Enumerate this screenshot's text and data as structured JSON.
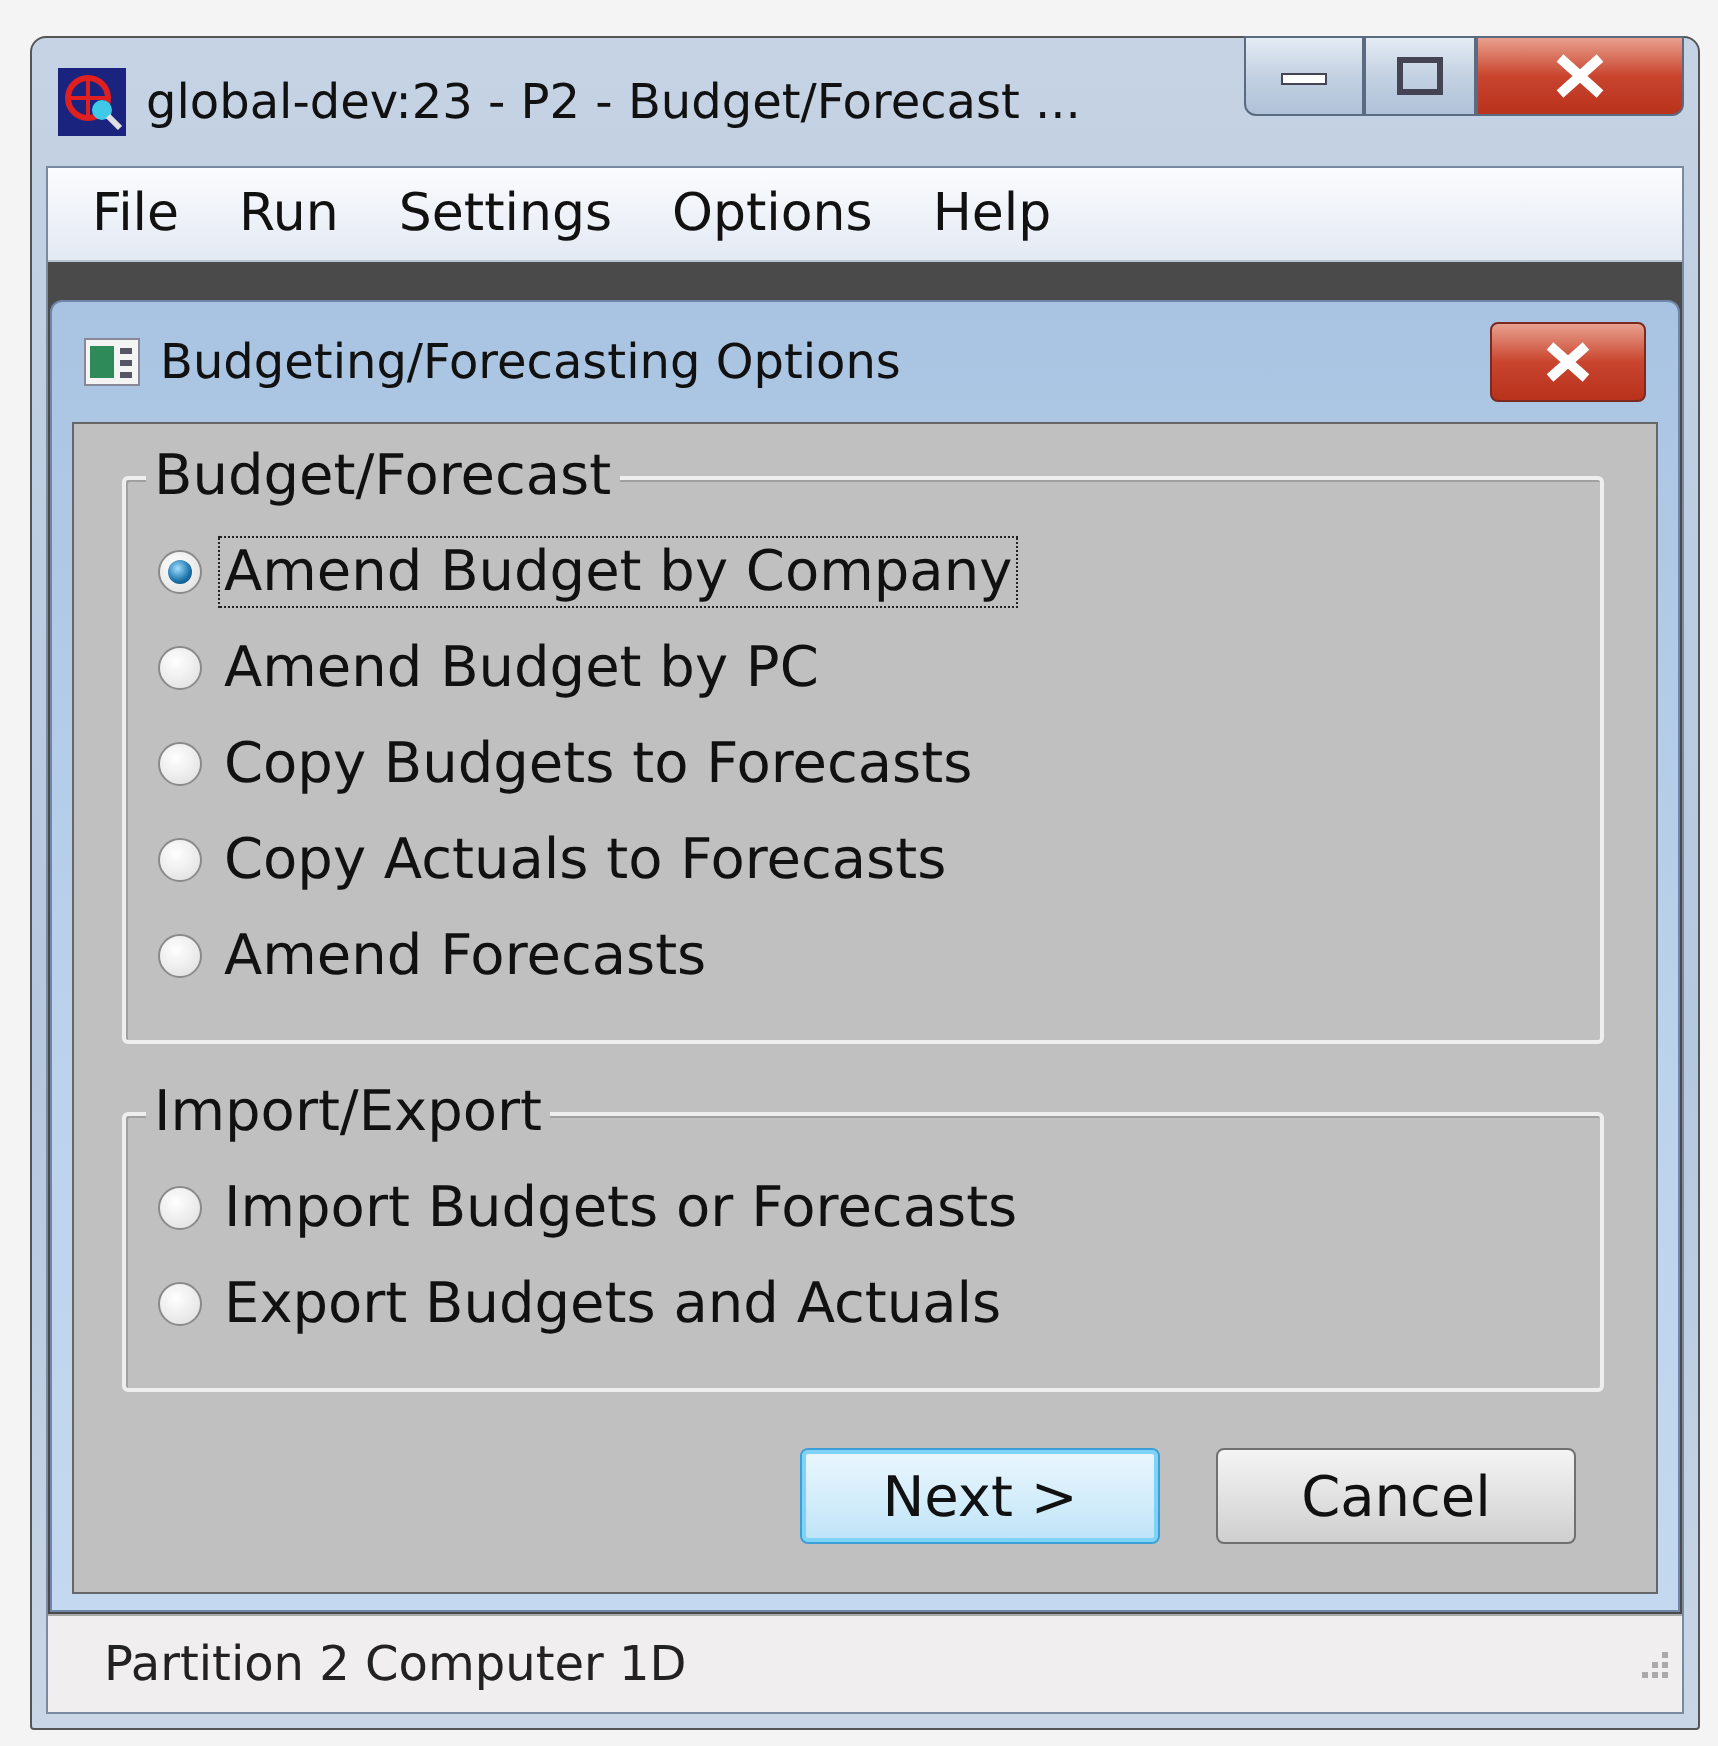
{
  "window": {
    "title": "global-dev:23 - P2 - Budget/Forecast ..."
  },
  "menu": [
    {
      "label": "File"
    },
    {
      "label": "Run"
    },
    {
      "label": "Settings"
    },
    {
      "label": "Options"
    },
    {
      "label": "Help"
    }
  ],
  "dialog": {
    "title": "Budgeting/Forecasting Options",
    "groups": [
      {
        "title": "Budget/Forecast",
        "options": [
          {
            "label": "Amend Budget by Company",
            "selected": true
          },
          {
            "label": "Amend Budget by PC",
            "selected": false
          },
          {
            "label": "Copy Budgets to Forecasts",
            "selected": false
          },
          {
            "label": "Copy Actuals to Forecasts",
            "selected": false
          },
          {
            "label": "Amend Forecasts",
            "selected": false
          }
        ]
      },
      {
        "title": "Import/Export",
        "options": [
          {
            "label": "Import Budgets or Forecasts",
            "selected": false
          },
          {
            "label": "Export Budgets and Actuals",
            "selected": false
          }
        ]
      }
    ],
    "buttons": [
      {
        "label": "Next >",
        "default": true
      },
      {
        "label": "Cancel",
        "default": false
      }
    ]
  },
  "status_bar": "Partition 2 Computer 1D"
}
